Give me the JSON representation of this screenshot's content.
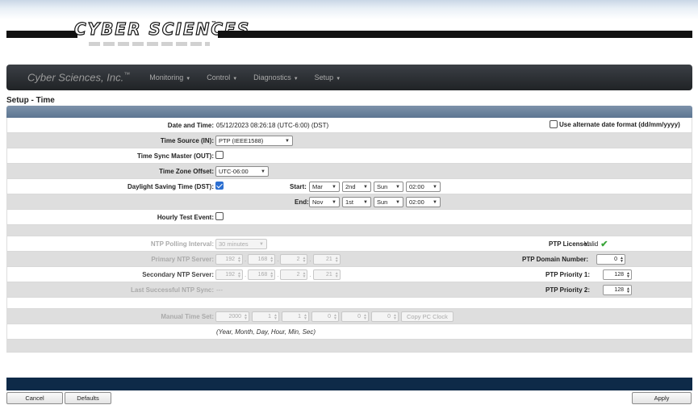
{
  "logo": {
    "text": "CYBER SCIENCES",
    "tm": "™"
  },
  "navbar": {
    "brand": "Cyber Sciences, Inc.",
    "brand_tm": "™",
    "items": [
      "Monitoring",
      "Control",
      "Diagnostics",
      "Setup"
    ]
  },
  "page_title": "Setup - Time",
  "date_time": {
    "label": "Date and Time:",
    "value": "05/12/2023 08:26:18 (UTC-6:00) (DST)",
    "alt_format_label": "Use alternate date format (dd/mm/yyyy)",
    "alt_format_checked": false
  },
  "time_source": {
    "label": "Time Source (IN):",
    "value": "PTP (IEEE1588)"
  },
  "time_sync_master": {
    "label": "Time Sync Master (OUT):",
    "checked": false
  },
  "time_zone": {
    "label": "Time Zone Offset:",
    "value": "UTC-06:00"
  },
  "dst": {
    "label": "Daylight Saving Time (DST):",
    "checked": true,
    "start_label": "Start:",
    "start": [
      "Mar",
      "2nd",
      "Sun",
      "02:00"
    ],
    "end_label": "End:",
    "end": [
      "Nov",
      "1st",
      "Sun",
      "02:00"
    ]
  },
  "hourly_test": {
    "label": "Hourly Test Event:",
    "checked": false
  },
  "ntp": {
    "polling_label": "NTP Polling Interval:",
    "polling_value": "30 minutes",
    "primary_label": "Primary NTP Server:",
    "primary": [
      "192",
      "168",
      "2",
      "21"
    ],
    "secondary_label": "Secondary NTP Server:",
    "secondary": [
      "192",
      "168",
      "2",
      "21"
    ],
    "last_sync_label": "Last Successful NTP Sync:",
    "last_sync_value": "---"
  },
  "ptp": {
    "license_label": "PTP License:",
    "license_value": "Valid",
    "domain_label": "PTP Domain Number:",
    "domain_value": "0",
    "priority1_label": "PTP Priority 1:",
    "priority1_value": "128",
    "priority2_label": "PTP Priority 2:",
    "priority2_value": "128"
  },
  "manual_time": {
    "label": "Manual Time Set:",
    "values": [
      "2000",
      "1",
      "1",
      "0",
      "0",
      "0"
    ],
    "copy_label": "Copy PC Clock",
    "hint": "(Year, Month, Day, Hour, Min, Sec)"
  },
  "buttons": {
    "cancel": "Cancel",
    "defaults": "Defaults",
    "apply": "Apply"
  },
  "colors": {
    "navbar": "#2a2d31",
    "panel_header": "#6b839e",
    "footer_bar": "#0e2a48",
    "checkbox_on": "#2c6fd1",
    "valid_check": "#3aa53a"
  }
}
